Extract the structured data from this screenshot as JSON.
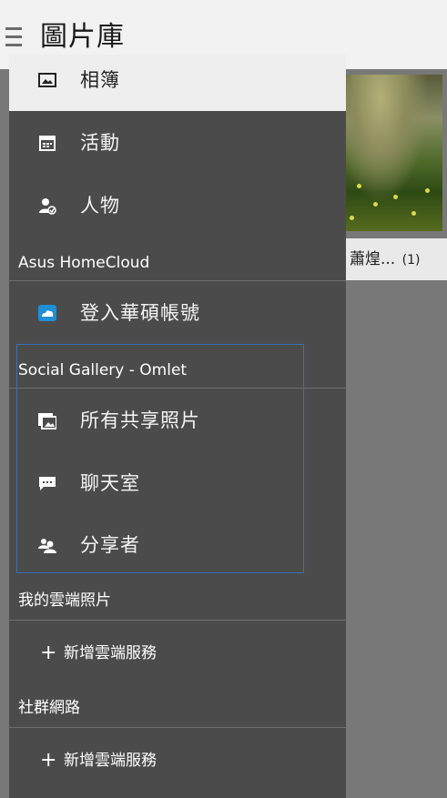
{
  "app": {
    "title": "圖片庫"
  },
  "thumbnail": {
    "name": "蕭煌...",
    "count": "(1)"
  },
  "drawer": {
    "top_item": {
      "icon": "photo-album-icon",
      "label": "相簿"
    },
    "items": [
      {
        "icon": "calendar-icon",
        "label": "活動"
      },
      {
        "icon": "person-icon",
        "label": "人物"
      }
    ],
    "homecloud": {
      "header": "Asus HomeCloud",
      "item": {
        "icon": "cloud-login-icon",
        "label": "登入華碩帳號"
      }
    },
    "social": {
      "header": "Social Gallery - Omlet",
      "items": [
        {
          "icon": "shared-photos-icon",
          "label": "所有共享照片"
        },
        {
          "icon": "chat-icon",
          "label": "聊天室"
        },
        {
          "icon": "sharers-icon",
          "label": "分享者"
        }
      ]
    },
    "cloud": {
      "header": "我的雲端照片",
      "add_label": "新增雲端服務",
      "plus": "+"
    },
    "social_network": {
      "header": "社群網路",
      "add_label": "新增雲端服務",
      "plus": "+"
    }
  },
  "colors": {
    "drawer_bg": "#4b4b4b",
    "highlight_border": "#3a6fb4",
    "cloud_icon": "#1e8fd6"
  }
}
